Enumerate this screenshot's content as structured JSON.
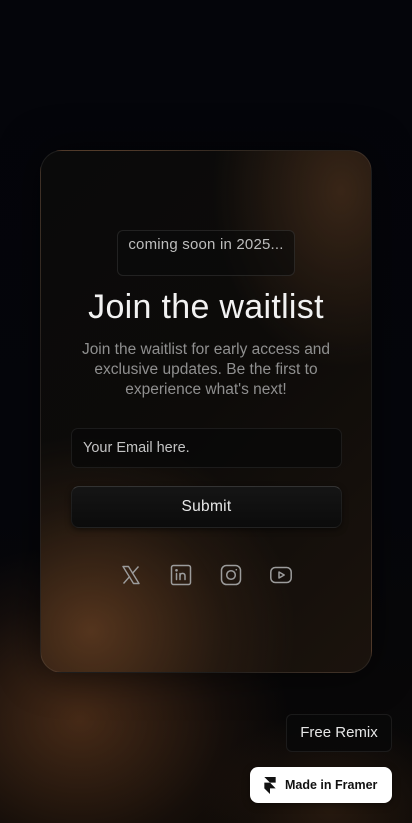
{
  "waitlist": {
    "badge_text": "coming soon in 2025...",
    "title": "Join the waitlist",
    "description": "Join the waitlist for early access and exclusive updates. Be the first to experience what's next!",
    "email_placeholder": "Your Email here.",
    "email_value": "",
    "submit_label": "Submit"
  },
  "socials": [
    {
      "name": "x",
      "icon": "x-icon"
    },
    {
      "name": "linkedin",
      "icon": "linkedin-icon"
    },
    {
      "name": "instagram",
      "icon": "instagram-icon"
    },
    {
      "name": "youtube",
      "icon": "youtube-icon"
    }
  ],
  "footer": {
    "remix_label": "Free Remix",
    "made_in_label": "Made in Framer"
  },
  "colors": {
    "background": "#05060b",
    "accent_glow": "#8c552d",
    "text_primary": "#f2f2f2",
    "text_muted": "#8f8f8f",
    "framer_badge_bg": "#ffffff"
  }
}
